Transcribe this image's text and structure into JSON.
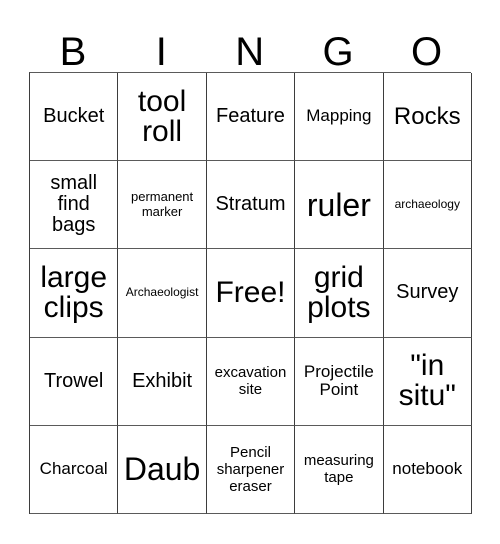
{
  "card": {
    "title_letters": [
      "B",
      "I",
      "N",
      "G",
      "O"
    ],
    "grid": {
      "rows": 5,
      "columns": 5,
      "border_color": "#3d3d3d",
      "background": "#ffffff",
      "text_color": "#000000",
      "cells": [
        [
          {
            "text": "Bucket",
            "size": "t-xl"
          },
          {
            "text": "tool\nroll",
            "size": "t-3xl"
          },
          {
            "text": "Feature",
            "size": "t-xl"
          },
          {
            "text": "Mapping",
            "size": "t-lg"
          },
          {
            "text": "Rocks",
            "size": "t-2xl"
          }
        ],
        [
          {
            "text": "small\nfind\nbags",
            "size": "t-xl"
          },
          {
            "text": "permanent\nmarker",
            "size": "t-sm"
          },
          {
            "text": "Stratum",
            "size": "t-xl"
          },
          {
            "text": "ruler",
            "size": "t-4xl"
          },
          {
            "text": "archaeology",
            "size": "t-xs"
          }
        ],
        [
          {
            "text": "large\nclips",
            "size": "t-3xl"
          },
          {
            "text": "Archaeologist",
            "size": "t-xs"
          },
          {
            "text": "Free!",
            "size": "t-3xl"
          },
          {
            "text": "grid\nplots",
            "size": "t-3xl"
          },
          {
            "text": "Survey",
            "size": "t-xl"
          }
        ],
        [
          {
            "text": "Trowel",
            "size": "t-xl"
          },
          {
            "text": "Exhibit",
            "size": "t-xl"
          },
          {
            "text": "excavation\nsite",
            "size": "t-md"
          },
          {
            "text": "Projectile\nPoint",
            "size": "t-lg"
          },
          {
            "text": "\"in\nsitu\"",
            "size": "t-3xl"
          }
        ],
        [
          {
            "text": "Charcoal",
            "size": "t-lg"
          },
          {
            "text": "Daub",
            "size": "t-4xl"
          },
          {
            "text": "Pencil\nsharpener\neraser",
            "size": "t-md"
          },
          {
            "text": "measuring\ntape",
            "size": "t-md"
          },
          {
            "text": "notebook",
            "size": "t-lg"
          }
        ]
      ]
    }
  }
}
